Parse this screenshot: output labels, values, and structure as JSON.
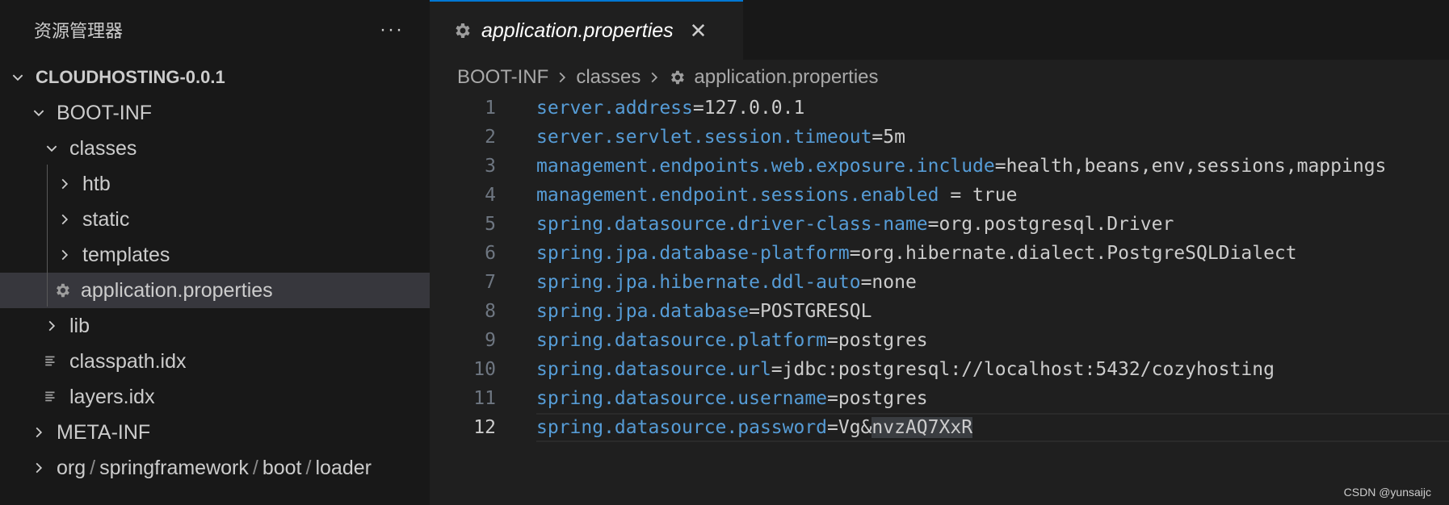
{
  "sidebar": {
    "title": "资源管理器",
    "more_icon": "···",
    "root": "CLOUDHOSTING-0.0.1",
    "items": {
      "boot_inf": "BOOT-INF",
      "classes": "classes",
      "htb": "htb",
      "static": "static",
      "templates": "templates",
      "application_properties": "application.properties",
      "lib": "lib",
      "classpath": "classpath.idx",
      "layers": "layers.idx",
      "meta_inf": "META-INF",
      "org_path": [
        "org",
        "springframework",
        "boot",
        "loader"
      ],
      "path_separator": "/"
    }
  },
  "editor": {
    "tab": {
      "label": "application.properties",
      "close": "✕"
    },
    "breadcrumb": [
      "BOOT-INF",
      "classes",
      "application.properties"
    ],
    "lines": [
      {
        "num": "1",
        "key": "server.address",
        "value": "=127.0.0.1"
      },
      {
        "num": "2",
        "key": "server.servlet.session.timeout",
        "value": "=5m"
      },
      {
        "num": "3",
        "key": "management.endpoints.web.exposure.include",
        "value": "=health,beans,env,sessions,mappings"
      },
      {
        "num": "4",
        "key": "management.endpoint.sessions.enabled",
        "value": " = true"
      },
      {
        "num": "5",
        "key": "spring.datasource.driver-class-name",
        "value": "=org.postgresql.Driver"
      },
      {
        "num": "6",
        "key": "spring.jpa.database-platform",
        "value": "=org.hibernate.dialect.PostgreSQLDialect"
      },
      {
        "num": "7",
        "key": "spring.jpa.hibernate.ddl-auto",
        "value": "=none"
      },
      {
        "num": "8",
        "key": "spring.jpa.database",
        "value": "=POSTGRESQL"
      },
      {
        "num": "9",
        "key": "spring.datasource.platform",
        "value": "=postgres"
      },
      {
        "num": "10",
        "key": "spring.datasource.url",
        "value": "=jdbc:postgresql://localhost:5432/cozyhosting"
      },
      {
        "num": "11",
        "key": "spring.datasource.username",
        "value": "=postgres"
      },
      {
        "num": "12",
        "key": "spring.datasource.password",
        "value": "=Vg&",
        "selected_value": "nvzAQ7XxR"
      }
    ]
  },
  "watermark": "CSDN @yunsaijc",
  "colors": {
    "key": "#569cd6",
    "accent": "#0078d4",
    "selection": "#37373d"
  }
}
